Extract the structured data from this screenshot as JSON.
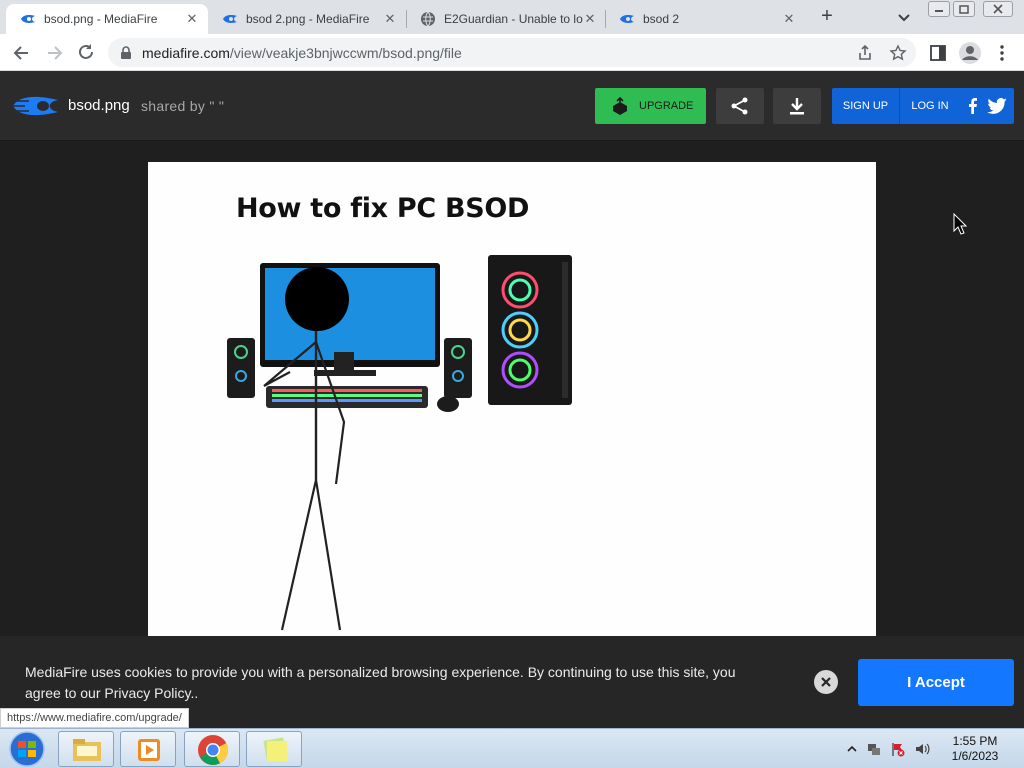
{
  "browser": {
    "tabs": [
      {
        "title": "bsod.png - MediaFire",
        "icon": "mediafire-favicon",
        "active": true
      },
      {
        "title": "bsod 2.png - MediaFire",
        "icon": "mediafire-favicon",
        "active": false
      },
      {
        "title": "E2Guardian - Unable to lo",
        "icon": "globe-favicon",
        "active": false
      },
      {
        "title": "bsod 2",
        "icon": "mediafire-favicon",
        "active": false
      }
    ],
    "url_host": "mediafire.com",
    "url_path": "/view/veakje3bnjwccwm/bsod.png/file"
  },
  "header": {
    "filename": "bsod.png",
    "shared_by": "shared by \" \"",
    "upgrade_label": "UPGRADE",
    "signup_label": "SIGN UP",
    "login_label": "LOG IN"
  },
  "image": {
    "title": "How to fix PC BSOD"
  },
  "cookie": {
    "text": "MediaFire uses cookies to provide you with a personalized browsing experience. By continuing to use this site, you agree to our Privacy Policy..",
    "accept_label": "I Accept"
  },
  "status_url": "https://www.mediafire.com/upgrade/",
  "taskbar": {
    "time": "1:55 PM",
    "date": "1/6/2023"
  },
  "colors": {
    "upgrade_green": "#2fbc52",
    "auth_blue": "#1164d8",
    "accept_blue": "#1377ff",
    "header_bg": "#2b2b2b"
  }
}
